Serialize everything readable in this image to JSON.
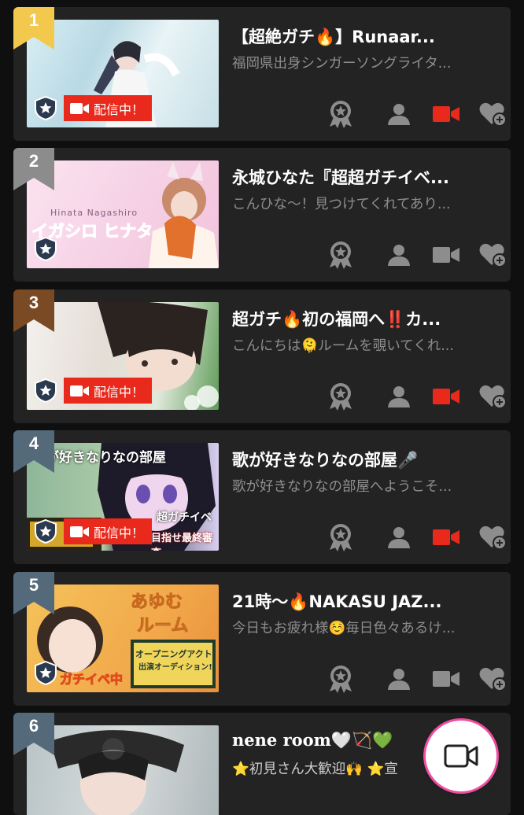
{
  "rooms": [
    {
      "rank": "1",
      "title": "【超絶ガチ🔥】Runaar...",
      "subtitle": "福岡県出身シンガーソングライタ...",
      "live_label": "配信中！",
      "is_live": true
    },
    {
      "rank": "2",
      "title": "永城ひなた『超超ガチイベ...",
      "subtitle": "こんひな〜！見つけてくれてあり...",
      "thumb_text": "イガシロ ヒナタ",
      "thumb_name": "Hinata Nagashiro",
      "is_live": false
    },
    {
      "rank": "3",
      "title": "超ガチ🔥初の福岡へ‼️カ...",
      "subtitle": "こんにちは🫠ルームを覗いてくれ...",
      "live_label": "配信中！",
      "is_live": true
    },
    {
      "rank": "4",
      "title": "歌が好きなりなの部屋🎤",
      "subtitle": "歌が好きなりなの部屋へようこそ...",
      "live_label": "配信中！",
      "thumb_text": "が好きなりなの部屋",
      "thumb_text2": "超ガチイベ",
      "thumb_text3": "目指せ最終審査",
      "is_live": true
    },
    {
      "rank": "5",
      "title": "21時〜🔥NAKASU JAZ...",
      "subtitle": "今日もお疲れ様☺️毎日色々あるけ...",
      "thumb_text": "あゆむ",
      "thumb_text2": "ルーム",
      "thumb_text3": "ガチイベ中",
      "thumb_text4": "オープニングアクト",
      "thumb_text5": "出演オーディション!",
      "is_live": false
    },
    {
      "rank": "6",
      "title": "nene room🤍🏹💚",
      "subtitle": "⭐初見さん大歓迎🙌 ⭐宣",
      "is_live": false
    }
  ],
  "icons": {
    "award": "award-icon",
    "user": "user-icon",
    "camera": "video-camera-icon",
    "heart": "heart-add-icon",
    "star_badge": "star-shield-icon"
  },
  "colors": {
    "live_red": "#e8291c",
    "rank_gold": "#f2c94c",
    "rank_silver": "#8c8c8c",
    "rank_bronze": "#7a4a25",
    "rank_default": "#546a7b",
    "fab_ring": "#f04ca0"
  },
  "fab": {
    "icon": "video-camera-icon"
  }
}
